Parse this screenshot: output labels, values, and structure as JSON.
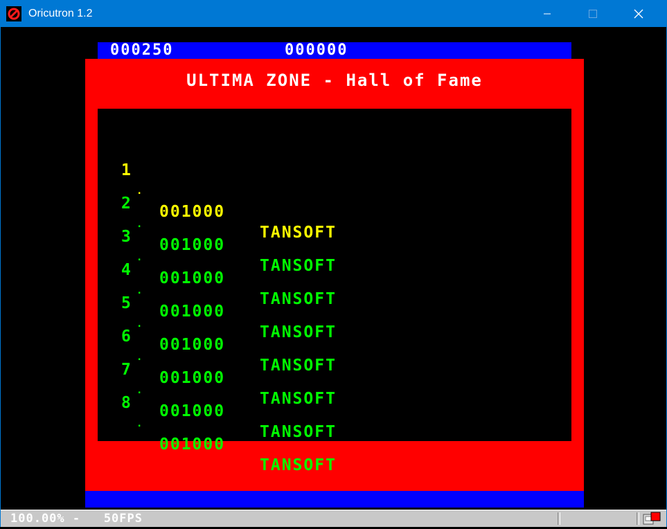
{
  "window": {
    "title": "Oricutron 1.2"
  },
  "colors": {
    "titlebar": "#0078d4",
    "border_blue": "#0000ff",
    "border_red": "#ff0000",
    "first_place": "#ffff00",
    "other_places": "#00ff00",
    "title_text": "#ffffff"
  },
  "game": {
    "score_left": "000250",
    "score_right": "000000",
    "hall_title": "ULTIMA ZONE - Hall of Fame",
    "entries": [
      {
        "rank": "1",
        "score": "001000",
        "name": "TANSOFT"
      },
      {
        "rank": "2",
        "score": "001000",
        "name": "TANSOFT"
      },
      {
        "rank": "3",
        "score": "001000",
        "name": "TANSOFT"
      },
      {
        "rank": "4",
        "score": "001000",
        "name": "TANSOFT"
      },
      {
        "rank": "5",
        "score": "001000",
        "name": "TANSOFT"
      },
      {
        "rank": "6",
        "score": "001000",
        "name": "TANSOFT"
      },
      {
        "rank": "7",
        "score": "001000",
        "name": "TANSOFT"
      },
      {
        "rank": "8",
        "score": "001000",
        "name": "TANSOFT"
      }
    ]
  },
  "status": {
    "text": "100.00% -   50FPS"
  }
}
